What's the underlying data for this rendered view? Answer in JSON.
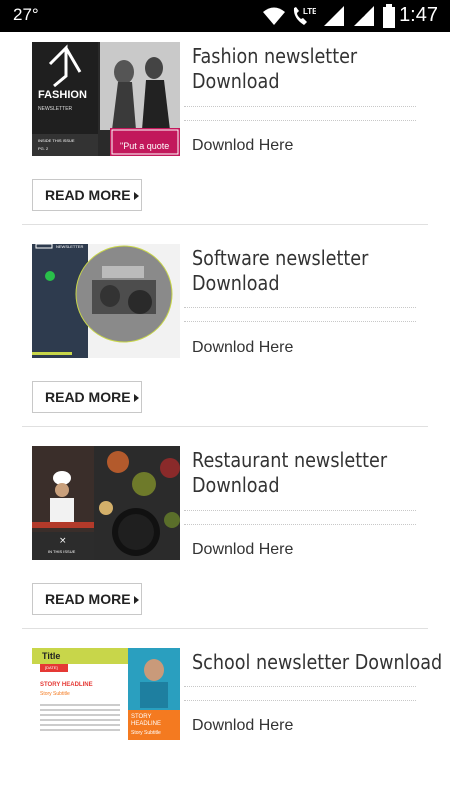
{
  "status": {
    "temperature": "27°",
    "time": "1:47"
  },
  "items": [
    {
      "title": "Fashion newsletter Download",
      "title_lines": [
        "Fashion newsletter",
        "Download"
      ],
      "download": "Downlod Here",
      "read_more": "READ MORE",
      "thumb_text": {
        "brand": "FASHION",
        "sub": "NEWSLETTER",
        "issue": "INSIDE THIS ISSUE",
        "pg": "PG. 2",
        "quote": "\"Put a quote"
      }
    },
    {
      "title": "Software newsletter Download",
      "title_lines": [
        "Software newsletter",
        "Download"
      ],
      "download": "Downlod Here",
      "read_more": "READ MORE",
      "thumb_text": {
        "header": "NEWSLETTER"
      }
    },
    {
      "title": "Restaurant newsletter Download",
      "title_lines": [
        "Restaurant newsletter",
        "Download"
      ],
      "download": "Downlod Here",
      "read_more": "READ MORE",
      "thumb_text": {
        "issue": "IN THIS ISSUE"
      }
    },
    {
      "title": "School newsletter Download",
      "title_lines": [
        "School newsletter Download"
      ],
      "download": "Downlod Here",
      "thumb_text": {
        "title": "Title",
        "date": "[DATE]",
        "headline": "STORY HEADLINE",
        "subtitle": "Story Subtitle",
        "story": "STORY",
        "headline2": "HEADLINE",
        "subtitle2": "Story Subtitle"
      }
    }
  ]
}
